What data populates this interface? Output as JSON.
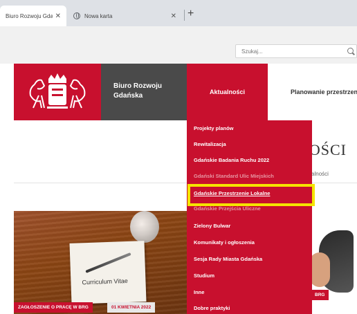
{
  "browser": {
    "tabs": [
      {
        "title": "Biuro Rozwoju Gda",
        "active": true
      },
      {
        "title": "Nowa karta",
        "active": false
      }
    ],
    "new_tab_label": "+",
    "close_label": "✕"
  },
  "site": {
    "brand_line1": "Biuro Rozwoju",
    "brand_line2": "Gdańska",
    "search_placeholder": "Szukaj...",
    "nav": {
      "news": "Aktualności",
      "planning": "Planowanie przestrzenne"
    }
  },
  "page": {
    "heading": "NOŚCI",
    "breadcrumb": "/ Aktualności"
  },
  "dropdown": {
    "items": [
      {
        "label": "Projekty planów"
      },
      {
        "label": "Rewitalizacja"
      },
      {
        "label": "Gdańskie Badania Ruchu 2022"
      },
      {
        "label": "Gdański Standard Ulic Miejskich"
      },
      {
        "label": "Gdańskie Przestrzenie Lokalne"
      },
      {
        "label": "Gdańskie Przejścia Uliczne"
      },
      {
        "label": "Zielony Bulwar"
      },
      {
        "label": "Komunikaty i ogłoszenia"
      },
      {
        "label": "Sesja Rady Miasta Gdańska"
      },
      {
        "label": "Studium"
      },
      {
        "label": "Inne"
      },
      {
        "label": "Dobre praktyki"
      }
    ],
    "highlighted_index": 4
  },
  "hero": {
    "cv_text": "Curriculum Vitae",
    "tag": "ZAGŁOSZENIE O PRACĘ W BRG",
    "date": "01 KWIETNIA 2022",
    "right_tag": "BRG"
  },
  "colors": {
    "brand_red": "#c8102e",
    "brand_gray": "#4a4a4a",
    "highlight": "#f5e400"
  }
}
